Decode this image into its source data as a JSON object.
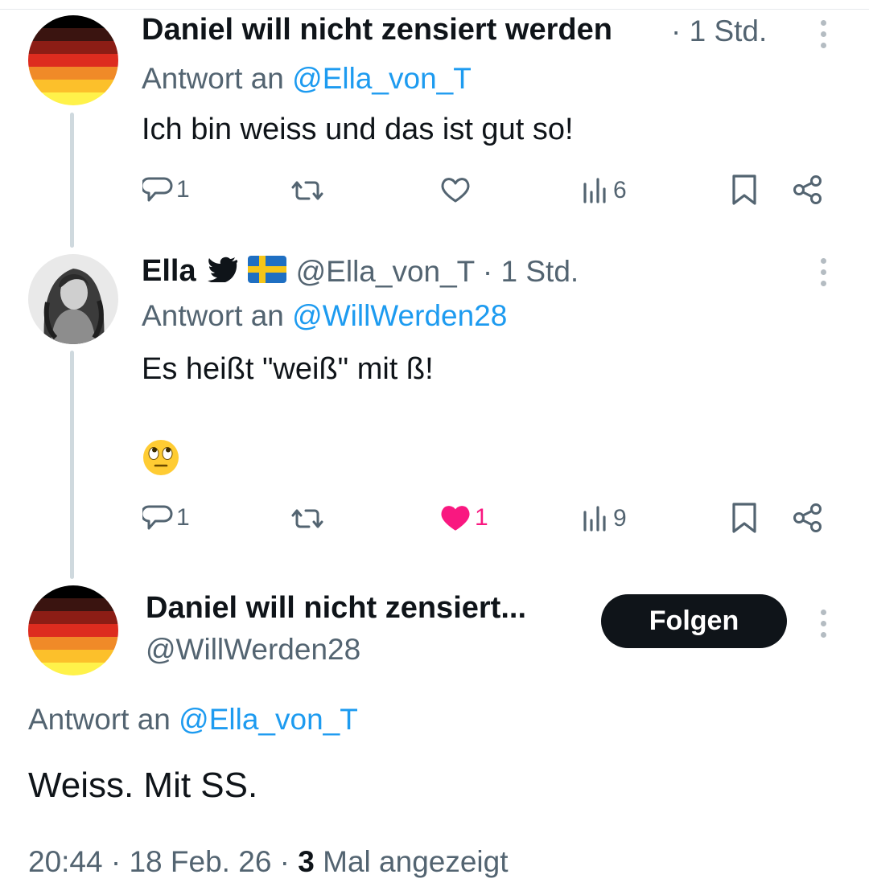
{
  "tweet1": {
    "name": "Daniel will nicht zensiert werden",
    "sep_time": "·",
    "time": "1 Std.",
    "reply_prefix": "Antwort an",
    "reply_to": "@Ella_von_T",
    "text": "Ich bin weiss und das ist gut so!",
    "replies": "1",
    "retweets": "",
    "likes": "",
    "views": "6"
  },
  "tweet2": {
    "name": "Ella",
    "handle": "@Ella_von_T",
    "sep_time": "·",
    "time": "1 Std.",
    "reply_prefix": "Antwort an",
    "reply_to": "@WillWerden28",
    "text": "Es heißt \"weiß\" mit ß!",
    "emoji": "🙄",
    "replies": "1",
    "retweets": "",
    "likes": "1",
    "liked": true,
    "views": "9"
  },
  "main": {
    "name": "Daniel will nicht zensiert...",
    "handle": "@WillWerden28",
    "follow_label": "Folgen",
    "reply_prefix": "Antwort an",
    "reply_to": "@Ella_von_T",
    "text": "Weiss. Mit SS.",
    "time": "20:44",
    "sep1": "·",
    "date": "18 Feb. 26",
    "sep2": "·",
    "views_count": "3",
    "views_label": "Mal angezeigt"
  },
  "colors": {
    "link": "#1d9bf0",
    "text": "#0f1419",
    "secondary": "#536471",
    "like_active": "#f91880",
    "follow_bg": "#0f1419"
  },
  "icons": {
    "reply": "speech-bubble-icon",
    "retweet": "retweet-arrows-icon",
    "like": "heart-icon",
    "views": "bar-chart-icon",
    "bookmark": "bookmark-icon",
    "share": "share-nodes-icon",
    "more": "vertical-dots-icon",
    "verified_bird": "bird-icon",
    "flag": "sweden-flag-icon"
  }
}
